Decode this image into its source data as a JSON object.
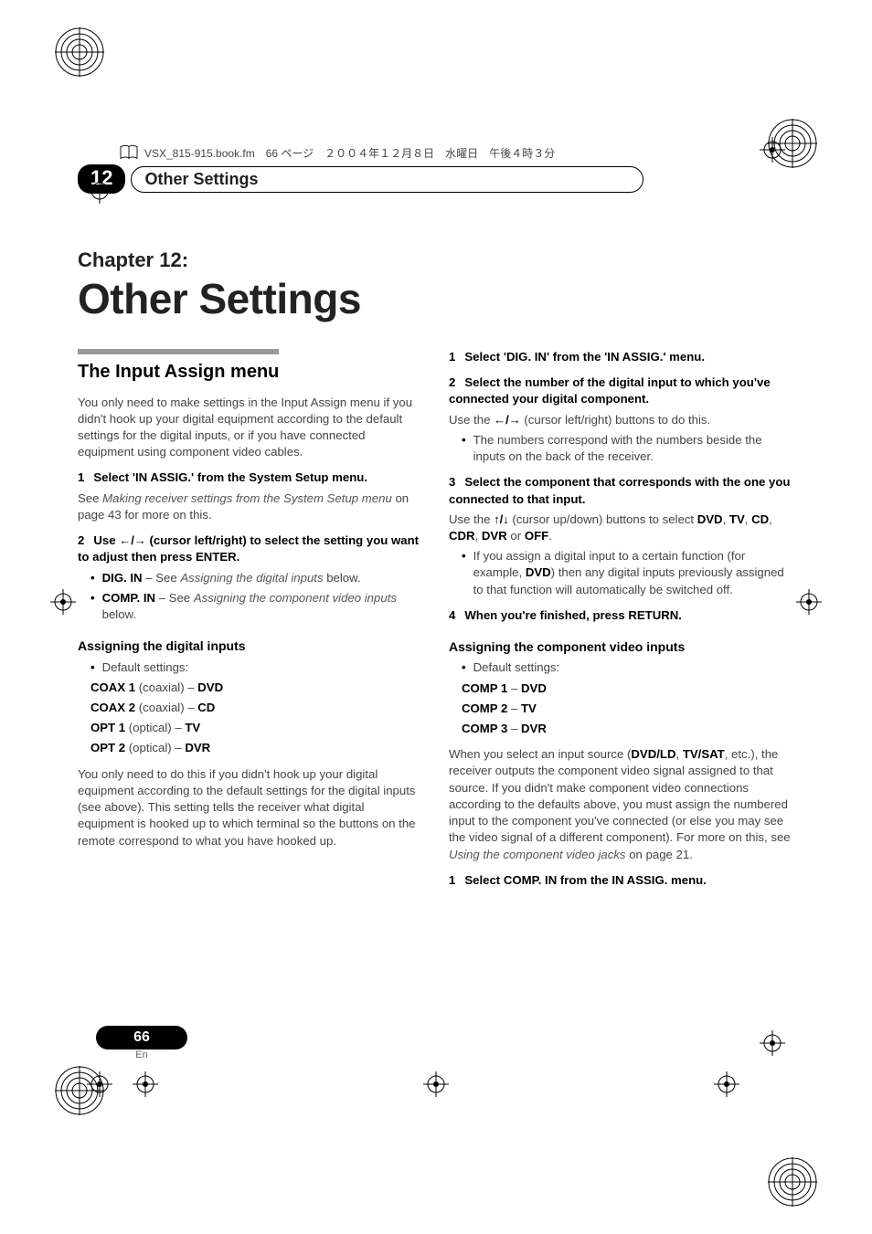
{
  "header": {
    "filename_line": "VSX_815-915.book.fm　66 ページ　２００４年１２月８日　水曜日　午後４時３分"
  },
  "tab": {
    "number": "12",
    "label": "Other Settings"
  },
  "chapter": {
    "label": "Chapter 12:",
    "title": "Other Settings"
  },
  "left": {
    "heading": "The Input Assign menu",
    "intro": "You only need to make settings in the Input Assign menu if you didn't hook up your digital equipment according to the default settings for the digital inputs, or if you have connected equipment using component video cables.",
    "step1_num": "1",
    "step1": "Select 'IN ASSIG.' from the System Setup menu.",
    "step1_note_a": "See ",
    "step1_note_em": "Making receiver settings from the System Setup menu",
    "step1_note_b": " on page 43 for more on this.",
    "step2_num": "2",
    "step2_a": "Use ",
    "step2_b": " (cursor left/right) to select the setting you want to adjust then press ENTER.",
    "bullet_digin_a": "DIG. IN",
    "bullet_digin_b": " – See ",
    "bullet_digin_em": "Assigning the digital inputs",
    "bullet_digin_c": " below.",
    "bullet_compin_a": "COMP. IN",
    "bullet_compin_b": " – See ",
    "bullet_compin_em": "Assigning the component video inputs",
    "bullet_compin_c": " below.",
    "sub1": "Assigning the digital inputs",
    "defaults_label": "Default settings:",
    "coax1_a": "COAX 1",
    "coax1_b": " (coaxial) – ",
    "coax1_c": "DVD",
    "coax2_a": "COAX 2",
    "coax2_b": " (coaxial) – ",
    "coax2_c": "CD",
    "opt1_a": "OPT 1",
    "opt1_b": " (optical) – ",
    "opt1_c": "TV",
    "opt2_a": "OPT 2",
    "opt2_b": " (optical) – ",
    "opt2_c": "DVR",
    "tail": "You only need to do this if you didn't hook up your digital equipment according to the default settings for the digital inputs (see above). This setting tells the receiver what digital equipment is hooked up to which terminal so the buttons on the remote correspond to what you have hooked up."
  },
  "right": {
    "r1_num": "1",
    "r1": "Select 'DIG. IN' from the 'IN ASSIG.' menu.",
    "r2_num": "2",
    "r2": "Select the number of the digital input to which you've connected your digital component.",
    "r2_tail_a": "Use the ",
    "r2_tail_b": " (cursor left/right) buttons to do this.",
    "r2_bullet": "The numbers correspond with the numbers beside the inputs on the back of the receiver.",
    "r3_num": "3",
    "r3": "Select the component that corresponds with the one you connected to that input.",
    "r3_tail_a": "Use the ",
    "r3_tail_b": " (cursor up/down) buttons to select ",
    "r3_tail_dvd": "DVD",
    "r3_tail_c1": ", ",
    "r3_tail_tv": "TV",
    "r3_tail_c2": ", ",
    "r3_tail_cd": "CD",
    "r3_tail_c3": ", ",
    "r3_tail_cdr": "CDR",
    "r3_tail_c4": ", ",
    "r3_tail_dvr": "DVR",
    "r3_tail_or": " or ",
    "r3_tail_off": "OFF",
    "r3_tail_end": ".",
    "r3_bullet_a": "If you assign a digital input to a certain function (for example, ",
    "r3_bullet_dvd": "DVD",
    "r3_bullet_b": ") then any digital inputs previously assigned to that function will automatically be switched off.",
    "r4_num": "4",
    "r4": "When you're finished, press RETURN.",
    "sub2": "Assigning the component video inputs",
    "defaults2": "Default settings:",
    "comp1_a": "COMP 1",
    "comp1_b": " – ",
    "comp1_c": "DVD",
    "comp2_a": "COMP 2",
    "comp2_b": " – ",
    "comp2_c": "TV",
    "comp3_a": "COMP 3",
    "comp3_b": " – ",
    "comp3_c": "DVR",
    "tail2_a": "When you select an input source (",
    "tail2_dvdld": "DVD/LD",
    "tail2_b": ", ",
    "tail2_tvsat": "TV/SAT",
    "tail2_c": ", etc.), the receiver outputs the component video signal assigned to that source. If you didn't make component video connections according to the defaults above, you must assign the numbered input to the component you've connected (or else you may see the video signal of a different component). For more on this, see ",
    "tail2_em": "Using the component video jacks",
    "tail2_d": " on page 21.",
    "r5_num": "1",
    "r5": "Select COMP. IN from the IN ASSIG. menu."
  },
  "footer": {
    "page": "66",
    "lang": "En"
  }
}
